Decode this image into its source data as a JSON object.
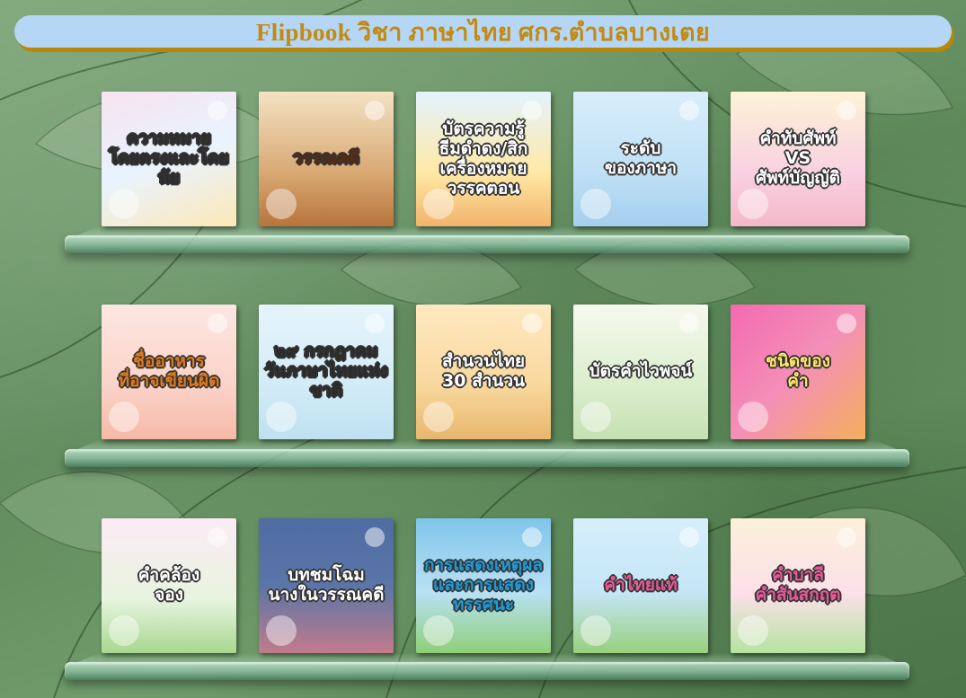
{
  "header": {
    "title": "Flipbook วิชา ภาษาไทย ศกร.ตำบลบางเตย"
  },
  "colors": {
    "title_text": "#c28a12",
    "title_bar": "#b5d6f5",
    "title_shadow": "#b8860b"
  },
  "shelves": [
    {
      "books": [
        {
          "label": "ความหมาย\nโดยตรงและโดยนัย",
          "bg": "linear-gradient(160deg,#f7e3f0,#e9f3ff 50%,#fde8b8)",
          "fg": "#2d2d2d"
        },
        {
          "label": "วรรณคดี",
          "bg": "linear-gradient(180deg,#f4e2c4,#d9a974 60%,#b8743c)",
          "fg": "#5a2a10"
        },
        {
          "label": "บัตรความรู้\nธีมดำดง/สิก\nเครื่องหมาย\nวรรคตอน",
          "bg": "linear-gradient(180deg,#e3f3ff,#ffe9a6 60%,#f2b36b)",
          "fg": "#ffffff"
        },
        {
          "label": "ระดับ\nของภาษา",
          "bg": "linear-gradient(180deg,#d9eefb,#bfe0f5 60%,#a4cfee)",
          "fg": "#ffffff"
        },
        {
          "label": "คำทับศัพท์\nVS\nศัพท์บัญญัติ",
          "bg": "linear-gradient(180deg,#fdf3d6,#f9d1e2 60%,#f4b8c9)",
          "fg": "#ffffff"
        }
      ]
    },
    {
      "books": [
        {
          "label": "ชื่ออาหาร\nที่อาจเขียนผิด",
          "bg": "linear-gradient(180deg,#fde7e2,#fbd3c9 60%,#f6b9a8)",
          "fg": "#e07a1f"
        },
        {
          "label": "๒๙ กรกฎาคม\nวันภาษาไทยแห่งชาติ",
          "bg": "linear-gradient(180deg,#e6f4fb,#d3ecf7 60%,#bfe0f1)",
          "fg": "#2b2b2b"
        },
        {
          "label": "สำนวนไทย\n30 สำนวน",
          "bg": "linear-gradient(180deg,#ffe9c2,#f9d89d 60%,#e8b66e)",
          "fg": "#ffffff"
        },
        {
          "label": "บัตรคำไวพจน์",
          "bg": "linear-gradient(180deg,#f6f9ee,#dbeecd 60%,#c6e0b3)",
          "fg": "#ffffff"
        },
        {
          "label": "ชนิดของ\nคำ",
          "bg": "linear-gradient(135deg,#f46ab0,#f48fb8 50%,#f3b05a)",
          "fg": "#ffe36b"
        }
      ]
    },
    {
      "books": [
        {
          "label": "คำคล้อง\nจอง",
          "bg": "linear-gradient(180deg,#fbeaf4,#e8f4e0 60%,#a8d88f)",
          "fg": "#ffffff"
        },
        {
          "label": "บทชมโฉมนางในวรรณคดี",
          "bg": "linear-gradient(180deg,#4f6da3,#5a75a8 50%,#c27b8b)",
          "fg": "#ffffff"
        },
        {
          "label": "การแสดงเหตุผล\nและการแสดง\nทรรศนะ",
          "bg": "linear-gradient(180deg,#7fc5ea,#b9e1f5 55%,#8fcf77)",
          "fg": "#1e9bd7"
        },
        {
          "label": "คำไทยแท้",
          "bg": "linear-gradient(180deg,#d7effb,#c4e6f7 55%,#98d07d)",
          "fg": "#e85a9a"
        },
        {
          "label": "คำบาลี\nคำสันสกฤต",
          "bg": "linear-gradient(180deg,#fbf0d8,#fde0ea 55%,#b6e3a0)",
          "fg": "#e85a9a"
        }
      ]
    }
  ]
}
